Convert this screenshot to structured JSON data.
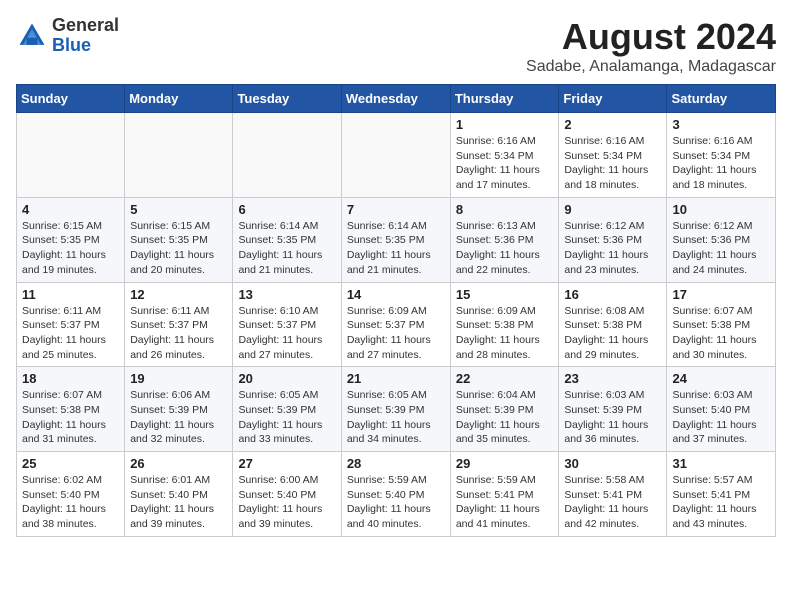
{
  "header": {
    "logo": {
      "line1": "General",
      "line2": "Blue"
    },
    "month_year": "August 2024",
    "location": "Sadabe, Analamanga, Madagascar"
  },
  "weekdays": [
    "Sunday",
    "Monday",
    "Tuesday",
    "Wednesday",
    "Thursday",
    "Friday",
    "Saturday"
  ],
  "weeks": [
    [
      {
        "day": "",
        "sunrise": "",
        "sunset": "",
        "daylight": ""
      },
      {
        "day": "",
        "sunrise": "",
        "sunset": "",
        "daylight": ""
      },
      {
        "day": "",
        "sunrise": "",
        "sunset": "",
        "daylight": ""
      },
      {
        "day": "",
        "sunrise": "",
        "sunset": "",
        "daylight": ""
      },
      {
        "day": "1",
        "sunrise": "Sunrise: 6:16 AM",
        "sunset": "Sunset: 5:34 PM",
        "daylight": "Daylight: 11 hours and 17 minutes."
      },
      {
        "day": "2",
        "sunrise": "Sunrise: 6:16 AM",
        "sunset": "Sunset: 5:34 PM",
        "daylight": "Daylight: 11 hours and 18 minutes."
      },
      {
        "day": "3",
        "sunrise": "Sunrise: 6:16 AM",
        "sunset": "Sunset: 5:34 PM",
        "daylight": "Daylight: 11 hours and 18 minutes."
      }
    ],
    [
      {
        "day": "4",
        "sunrise": "Sunrise: 6:15 AM",
        "sunset": "Sunset: 5:35 PM",
        "daylight": "Daylight: 11 hours and 19 minutes."
      },
      {
        "day": "5",
        "sunrise": "Sunrise: 6:15 AM",
        "sunset": "Sunset: 5:35 PM",
        "daylight": "Daylight: 11 hours and 20 minutes."
      },
      {
        "day": "6",
        "sunrise": "Sunrise: 6:14 AM",
        "sunset": "Sunset: 5:35 PM",
        "daylight": "Daylight: 11 hours and 21 minutes."
      },
      {
        "day": "7",
        "sunrise": "Sunrise: 6:14 AM",
        "sunset": "Sunset: 5:35 PM",
        "daylight": "Daylight: 11 hours and 21 minutes."
      },
      {
        "day": "8",
        "sunrise": "Sunrise: 6:13 AM",
        "sunset": "Sunset: 5:36 PM",
        "daylight": "Daylight: 11 hours and 22 minutes."
      },
      {
        "day": "9",
        "sunrise": "Sunrise: 6:12 AM",
        "sunset": "Sunset: 5:36 PM",
        "daylight": "Daylight: 11 hours and 23 minutes."
      },
      {
        "day": "10",
        "sunrise": "Sunrise: 6:12 AM",
        "sunset": "Sunset: 5:36 PM",
        "daylight": "Daylight: 11 hours and 24 minutes."
      }
    ],
    [
      {
        "day": "11",
        "sunrise": "Sunrise: 6:11 AM",
        "sunset": "Sunset: 5:37 PM",
        "daylight": "Daylight: 11 hours and 25 minutes."
      },
      {
        "day": "12",
        "sunrise": "Sunrise: 6:11 AM",
        "sunset": "Sunset: 5:37 PM",
        "daylight": "Daylight: 11 hours and 26 minutes."
      },
      {
        "day": "13",
        "sunrise": "Sunrise: 6:10 AM",
        "sunset": "Sunset: 5:37 PM",
        "daylight": "Daylight: 11 hours and 27 minutes."
      },
      {
        "day": "14",
        "sunrise": "Sunrise: 6:09 AM",
        "sunset": "Sunset: 5:37 PM",
        "daylight": "Daylight: 11 hours and 27 minutes."
      },
      {
        "day": "15",
        "sunrise": "Sunrise: 6:09 AM",
        "sunset": "Sunset: 5:38 PM",
        "daylight": "Daylight: 11 hours and 28 minutes."
      },
      {
        "day": "16",
        "sunrise": "Sunrise: 6:08 AM",
        "sunset": "Sunset: 5:38 PM",
        "daylight": "Daylight: 11 hours and 29 minutes."
      },
      {
        "day": "17",
        "sunrise": "Sunrise: 6:07 AM",
        "sunset": "Sunset: 5:38 PM",
        "daylight": "Daylight: 11 hours and 30 minutes."
      }
    ],
    [
      {
        "day": "18",
        "sunrise": "Sunrise: 6:07 AM",
        "sunset": "Sunset: 5:38 PM",
        "daylight": "Daylight: 11 hours and 31 minutes."
      },
      {
        "day": "19",
        "sunrise": "Sunrise: 6:06 AM",
        "sunset": "Sunset: 5:39 PM",
        "daylight": "Daylight: 11 hours and 32 minutes."
      },
      {
        "day": "20",
        "sunrise": "Sunrise: 6:05 AM",
        "sunset": "Sunset: 5:39 PM",
        "daylight": "Daylight: 11 hours and 33 minutes."
      },
      {
        "day": "21",
        "sunrise": "Sunrise: 6:05 AM",
        "sunset": "Sunset: 5:39 PM",
        "daylight": "Daylight: 11 hours and 34 minutes."
      },
      {
        "day": "22",
        "sunrise": "Sunrise: 6:04 AM",
        "sunset": "Sunset: 5:39 PM",
        "daylight": "Daylight: 11 hours and 35 minutes."
      },
      {
        "day": "23",
        "sunrise": "Sunrise: 6:03 AM",
        "sunset": "Sunset: 5:39 PM",
        "daylight": "Daylight: 11 hours and 36 minutes."
      },
      {
        "day": "24",
        "sunrise": "Sunrise: 6:03 AM",
        "sunset": "Sunset: 5:40 PM",
        "daylight": "Daylight: 11 hours and 37 minutes."
      }
    ],
    [
      {
        "day": "25",
        "sunrise": "Sunrise: 6:02 AM",
        "sunset": "Sunset: 5:40 PM",
        "daylight": "Daylight: 11 hours and 38 minutes."
      },
      {
        "day": "26",
        "sunrise": "Sunrise: 6:01 AM",
        "sunset": "Sunset: 5:40 PM",
        "daylight": "Daylight: 11 hours and 39 minutes."
      },
      {
        "day": "27",
        "sunrise": "Sunrise: 6:00 AM",
        "sunset": "Sunset: 5:40 PM",
        "daylight": "Daylight: 11 hours and 39 minutes."
      },
      {
        "day": "28",
        "sunrise": "Sunrise: 5:59 AM",
        "sunset": "Sunset: 5:40 PM",
        "daylight": "Daylight: 11 hours and 40 minutes."
      },
      {
        "day": "29",
        "sunrise": "Sunrise: 5:59 AM",
        "sunset": "Sunset: 5:41 PM",
        "daylight": "Daylight: 11 hours and 41 minutes."
      },
      {
        "day": "30",
        "sunrise": "Sunrise: 5:58 AM",
        "sunset": "Sunset: 5:41 PM",
        "daylight": "Daylight: 11 hours and 42 minutes."
      },
      {
        "day": "31",
        "sunrise": "Sunrise: 5:57 AM",
        "sunset": "Sunset: 5:41 PM",
        "daylight": "Daylight: 11 hours and 43 minutes."
      }
    ]
  ]
}
